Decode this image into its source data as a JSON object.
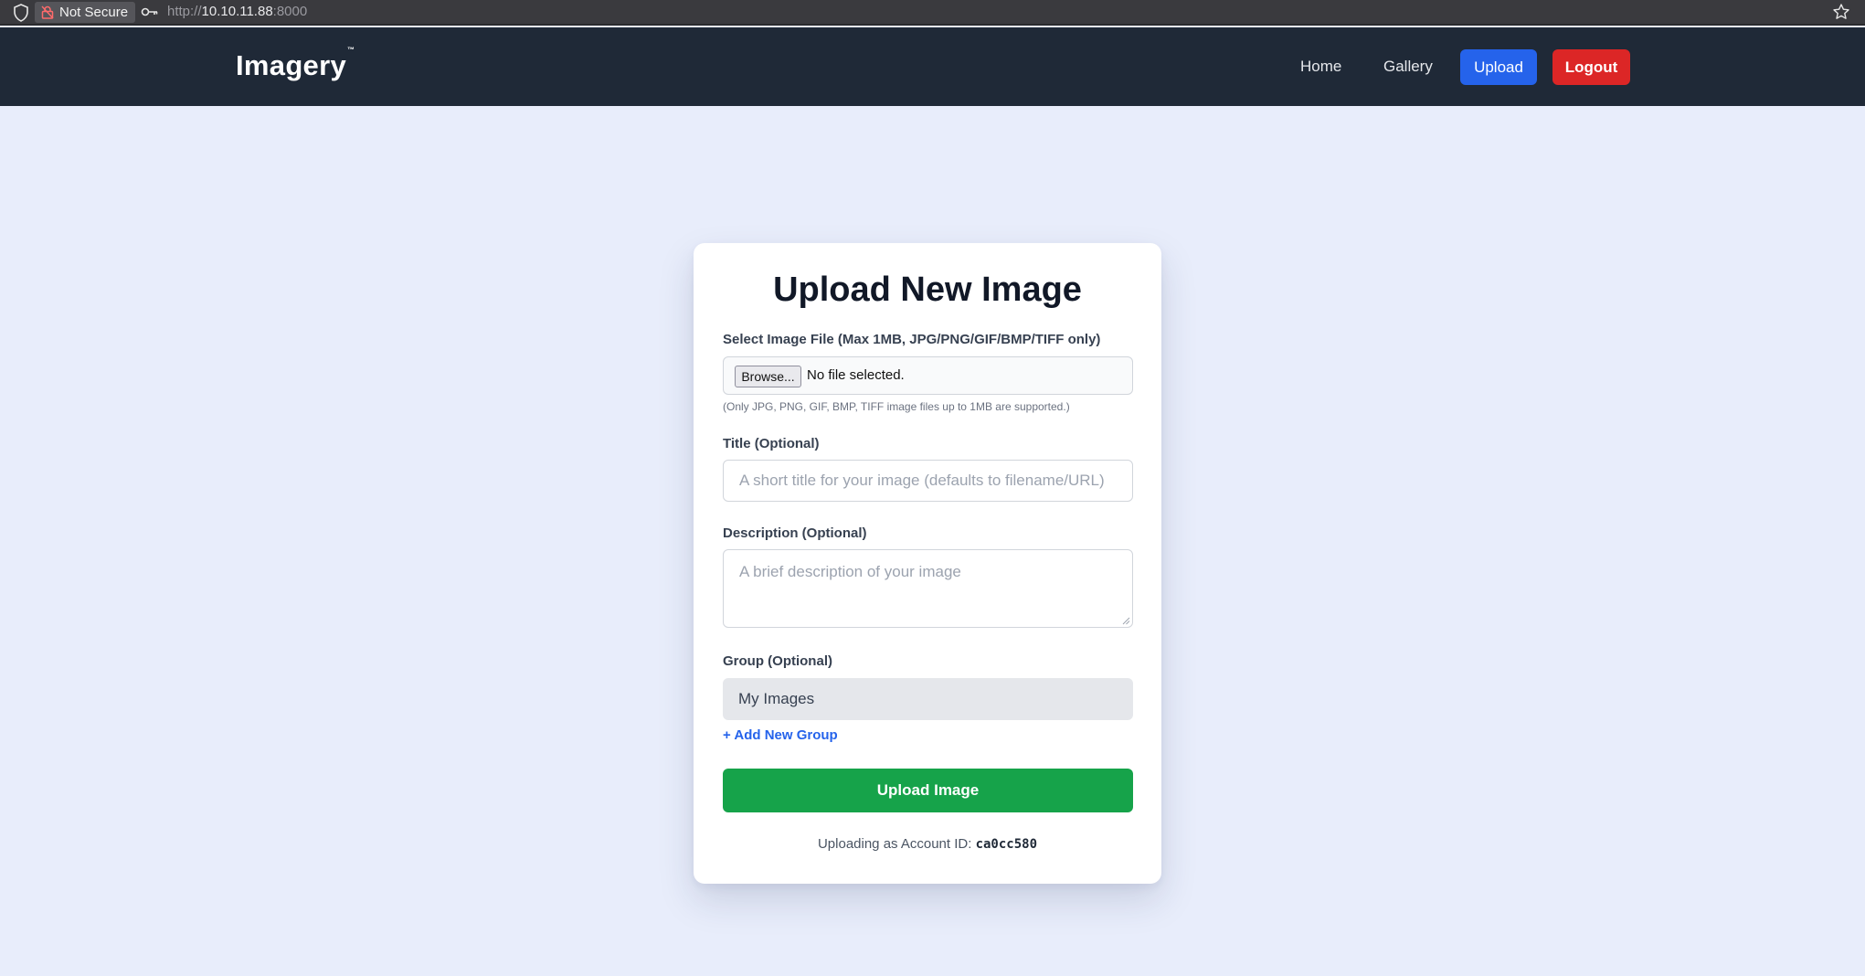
{
  "browser": {
    "security_label": "Not Secure",
    "url_scheme": "http://",
    "url_host": "10.10.11.88",
    "url_port": ":8000"
  },
  "navbar": {
    "brand": "Imagery",
    "brand_tm": "™",
    "links": {
      "home": "Home",
      "gallery": "Gallery",
      "upload": "Upload",
      "logout": "Logout"
    },
    "colors": {
      "upload": "#2563eb",
      "logout": "#dc2626",
      "background": "#1f2937"
    }
  },
  "form": {
    "heading": "Upload New Image",
    "file": {
      "label": "Select Image File (Max 1MB, JPG/PNG/GIF/BMP/TIFF only)",
      "browse_label": "Browse...",
      "status": "No file selected.",
      "hint": "(Only JPG, PNG, GIF, BMP, TIFF image files up to 1MB are supported.)"
    },
    "title": {
      "label": "Title (Optional)",
      "placeholder": "A short title for your image (defaults to filename/URL)",
      "value": ""
    },
    "description": {
      "label": "Description (Optional)",
      "placeholder": "A brief description of your image",
      "value": ""
    },
    "group": {
      "label": "Group (Optional)",
      "selected": "My Images"
    },
    "add_group_label": "+ Add New Group",
    "submit_label": "Upload Image",
    "submit_color": "#16a34a",
    "account_prefix": "Uploading as Account ID:",
    "account_id": "ca0cc580"
  }
}
